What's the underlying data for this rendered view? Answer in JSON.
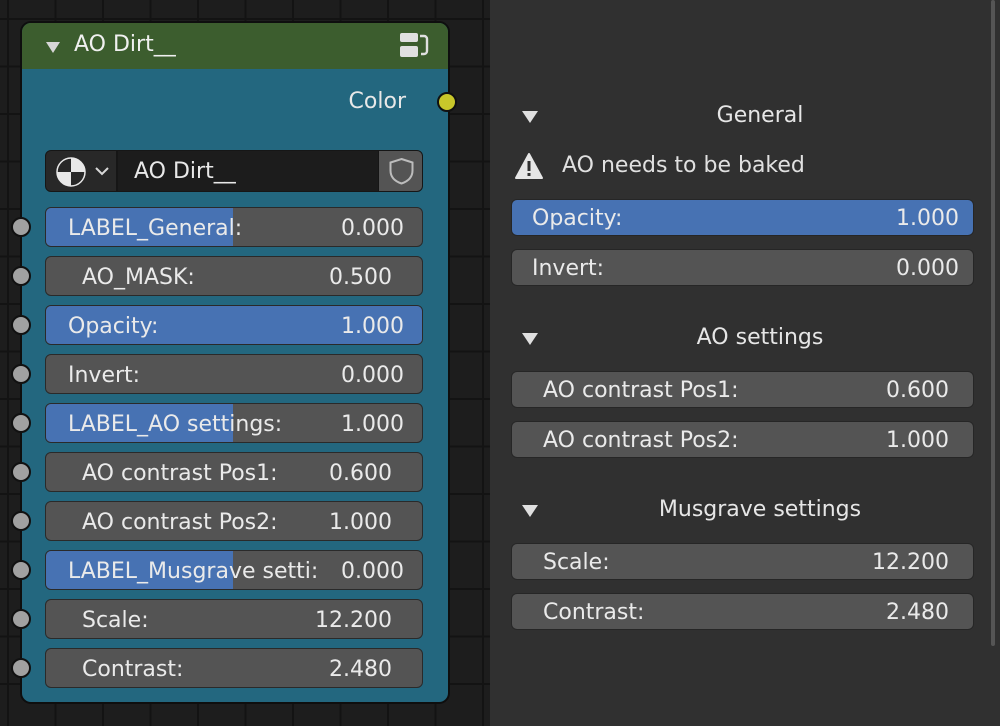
{
  "node": {
    "title": "AO Dirt__",
    "header_color": "#3c5d2e",
    "body_color": "#23677f",
    "output": {
      "label": "Color",
      "socket_color": "#c8c72a"
    },
    "datablock": {
      "name": "AO Dirt__",
      "type_icon": "node-tree-icon",
      "fake_user_icon": "shield-icon"
    },
    "inputs": [
      {
        "label": "LABEL_General:",
        "value": "0.000",
        "style": "label-field"
      },
      {
        "label": "AO_MASK:",
        "value": "0.500",
        "style": "indented"
      },
      {
        "label": "Opacity:",
        "value": "1.000",
        "style": "selected"
      },
      {
        "label": "Invert:",
        "value": "0.000",
        "style": "plain"
      },
      {
        "label": "LABEL_AO settings:",
        "value": "1.000",
        "style": "label-field"
      },
      {
        "label": "AO contrast Pos1:",
        "value": "0.600",
        "style": "indented"
      },
      {
        "label": "AO contrast Pos2:",
        "value": "1.000",
        "style": "indented"
      },
      {
        "label": "LABEL_Musgrave setti:",
        "value": "0.000",
        "style": "label-field"
      },
      {
        "label": "Scale:",
        "value": "12.200",
        "style": "indented"
      },
      {
        "label": "Contrast:",
        "value": "2.480",
        "style": "indented"
      }
    ]
  },
  "sidebar": {
    "general": {
      "title": "General",
      "warning": "AO needs to be baked",
      "fields": [
        {
          "label": "Opacity:",
          "value": "1.000",
          "selected": true
        },
        {
          "label": "Invert:",
          "value": "0.000",
          "selected": false
        }
      ]
    },
    "ao_settings": {
      "title": "AO settings",
      "fields": [
        {
          "label": "AO contrast Pos1:",
          "value": "0.600"
        },
        {
          "label": "AO contrast Pos2:",
          "value": "1.000"
        }
      ]
    },
    "musgrave_settings": {
      "title": "Musgrave settings",
      "fields": [
        {
          "label": "Scale:",
          "value": "12.200"
        },
        {
          "label": "Contrast:",
          "value": "2.480"
        }
      ]
    }
  },
  "colors": {
    "selected_field": "#4772b3",
    "field": "#545454",
    "panel_bg": "#303030"
  }
}
